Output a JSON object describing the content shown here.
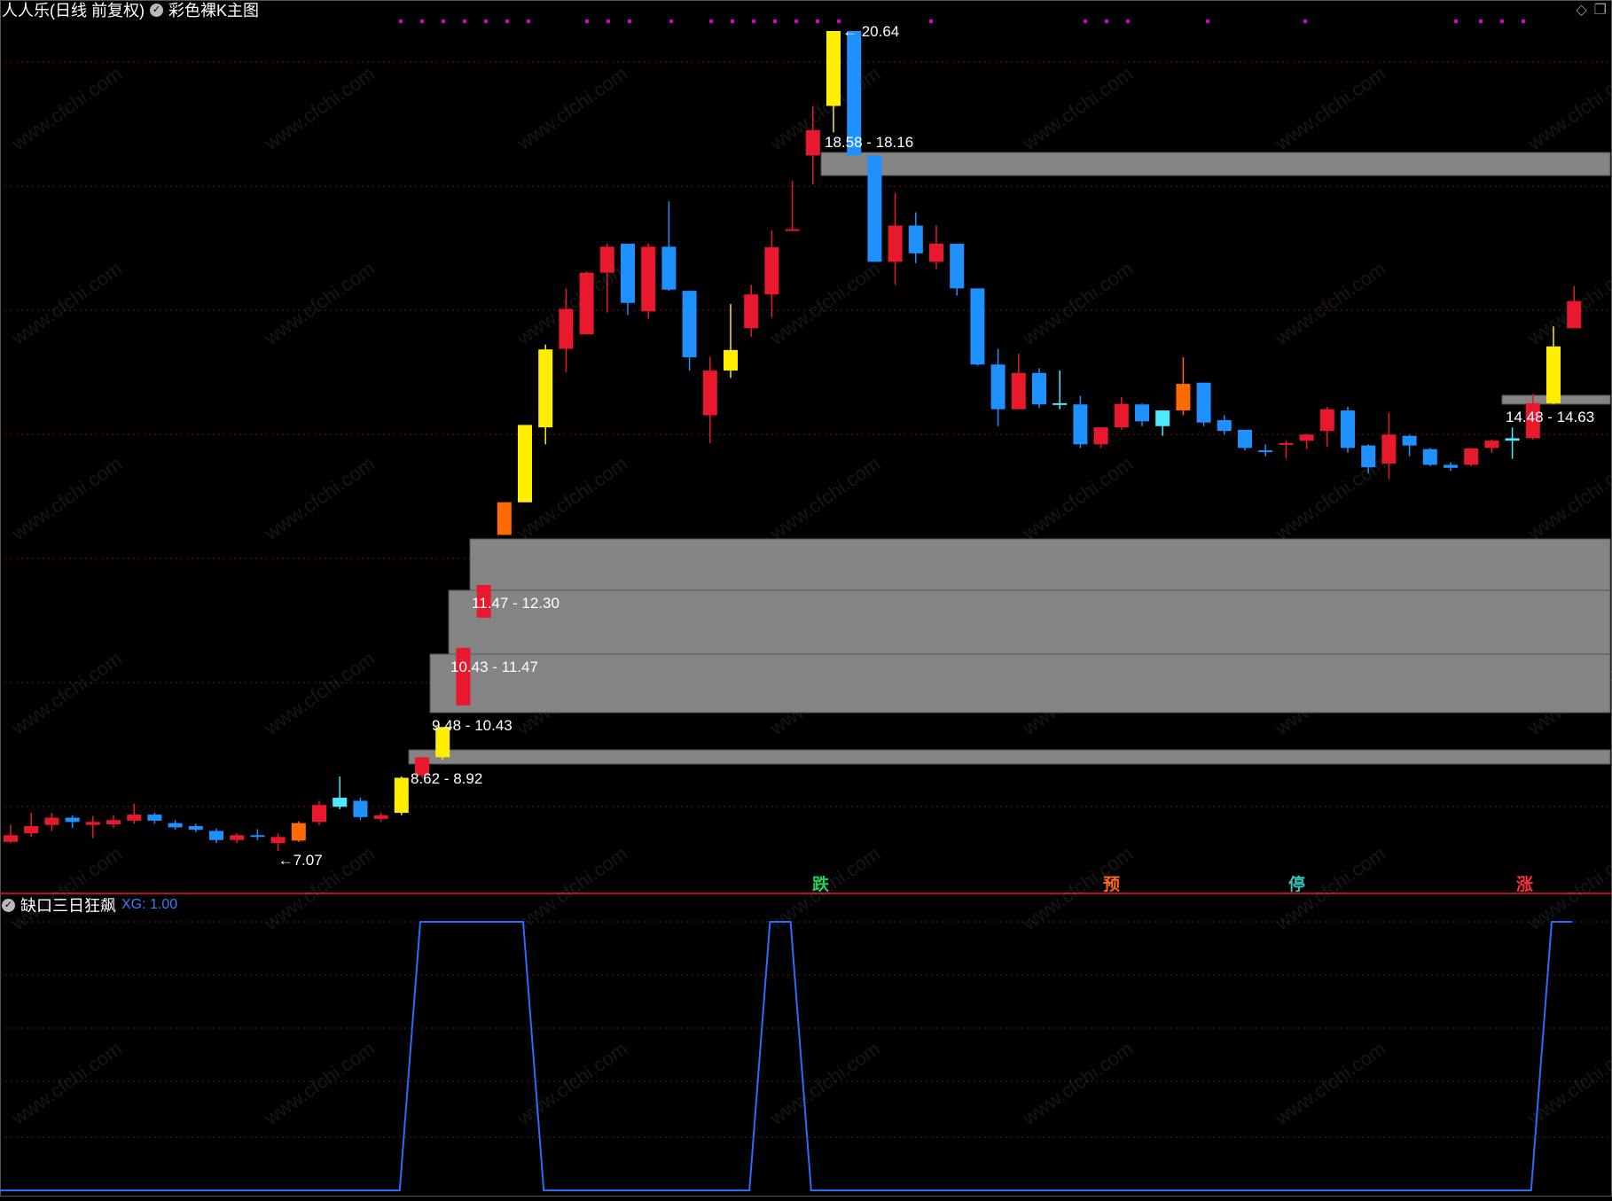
{
  "main_panel": {
    "stock_name": "人人乐(日线 前复权)",
    "indicator_name": "彩色裸K主图"
  },
  "sub_panel": {
    "indicator_name": "缺口三日狂飙",
    "xg_label": "XG: 1.00"
  },
  "icons": [
    "check-circle-icon",
    "diamond-icon",
    "window-restore-icon"
  ],
  "colors": {
    "background": "#000000",
    "grid": "#7a1010",
    "gap_band": "#848484",
    "up": "#e8192c",
    "down": "#1e90ff",
    "yellow": "#ffee00",
    "green": "#00e000",
    "orange": "#ff6a00",
    "cyan": "#4ee8ff",
    "xg_line": "#2a6cff",
    "dots": "#d000d0"
  },
  "price_labels": {
    "high": "20.64",
    "low": "7.07"
  },
  "gaps": [
    {
      "label": "18.58 - 18.16"
    },
    {
      "label": "14.48 - 14.63"
    },
    {
      "label": "11.47 - 12.30"
    },
    {
      "label": "10.43 - 11.47"
    },
    {
      "label": "9.48 - 10.43"
    },
    {
      "label": "8.62 - 8.92"
    }
  ],
  "signals": [
    {
      "text": "跌",
      "color": "#1fd05a"
    },
    {
      "text": "预",
      "color": "#ff6a1a"
    },
    {
      "text": "停",
      "color": "#39c0c0"
    },
    {
      "text": "涨",
      "color": "#ff3040"
    }
  ],
  "candles": [
    {
      "o": 7.33,
      "h": 7.5,
      "l": 7.2,
      "c": 7.22,
      "k": "red"
    },
    {
      "o": 7.36,
      "h": 7.7,
      "l": 7.3,
      "c": 7.48,
      "k": "red"
    },
    {
      "o": 7.5,
      "h": 7.7,
      "l": 7.4,
      "c": 7.62,
      "k": "red"
    },
    {
      "o": 7.62,
      "h": 7.66,
      "l": 7.45,
      "c": 7.55,
      "k": "blue"
    },
    {
      "o": 7.5,
      "h": 7.65,
      "l": 7.28,
      "c": 7.55,
      "k": "red"
    },
    {
      "o": 7.51,
      "h": 7.66,
      "l": 7.45,
      "c": 7.58,
      "k": "red"
    },
    {
      "o": 7.57,
      "h": 7.85,
      "l": 7.52,
      "c": 7.67,
      "k": "red"
    },
    {
      "o": 7.67,
      "h": 7.7,
      "l": 7.52,
      "c": 7.57,
      "k": "blue"
    },
    {
      "o": 7.53,
      "h": 7.58,
      "l": 7.42,
      "c": 7.46,
      "k": "blue"
    },
    {
      "o": 7.48,
      "h": 7.52,
      "l": 7.38,
      "c": 7.42,
      "k": "blue"
    },
    {
      "o": 7.4,
      "h": 7.44,
      "l": 7.2,
      "c": 7.25,
      "k": "blue"
    },
    {
      "o": 7.25,
      "h": 7.36,
      "l": 7.2,
      "c": 7.33,
      "k": "red"
    },
    {
      "o": 7.33,
      "h": 7.43,
      "l": 7.25,
      "c": 7.32,
      "k": "blue"
    },
    {
      "o": 7.3,
      "h": 7.36,
      "l": 7.07,
      "c": 7.2,
      "k": "red"
    },
    {
      "o": 7.24,
      "h": 7.56,
      "l": 7.22,
      "c": 7.53,
      "k": "orange"
    },
    {
      "o": 7.55,
      "h": 7.9,
      "l": 7.5,
      "c": 7.83,
      "k": "red"
    },
    {
      "o": 7.8,
      "h": 8.3,
      "l": 7.76,
      "c": 7.95,
      "k": "cyan"
    },
    {
      "o": 7.9,
      "h": 7.95,
      "l": 7.58,
      "c": 7.63,
      "k": "blue"
    },
    {
      "o": 7.6,
      "h": 7.7,
      "l": 7.55,
      "c": 7.66,
      "k": "red"
    },
    {
      "o": 7.7,
      "h": 8.3,
      "l": 7.66,
      "c": 8.28,
      "k": "yellow"
    },
    {
      "o": 8.32,
      "h": 8.62,
      "l": 8.28,
      "c": 8.62,
      "k": "red"
    },
    {
      "o": 8.62,
      "h": 9.12,
      "l": 8.58,
      "c": 9.12,
      "k": "yellow"
    },
    {
      "o": 9.48,
      "h": 10.43,
      "l": 9.48,
      "c": 10.43,
      "k": "red"
    },
    {
      "o": 10.93,
      "h": 11.47,
      "l": 10.93,
      "c": 11.47,
      "k": "red"
    },
    {
      "o": 12.3,
      "h": 12.84,
      "l": 12.3,
      "c": 12.84,
      "k": "orange"
    },
    {
      "o": 12.84,
      "h": 14.12,
      "l": 12.84,
      "c": 14.12,
      "k": "yellow"
    },
    {
      "o": 14.08,
      "h": 15.45,
      "l": 13.8,
      "c": 15.37,
      "k": "yellow"
    },
    {
      "o": 15.38,
      "h": 16.38,
      "l": 15.0,
      "c": 16.04,
      "k": "red"
    },
    {
      "o": 15.62,
      "h": 16.66,
      "l": 15.62,
      "c": 16.64,
      "k": "red"
    },
    {
      "o": 16.64,
      "h": 17.12,
      "l": 15.98,
      "c": 17.07,
      "k": "red"
    },
    {
      "o": 17.12,
      "h": 17.12,
      "l": 15.94,
      "c": 16.14,
      "k": "blue"
    },
    {
      "o": 17.07,
      "h": 17.12,
      "l": 15.88,
      "c": 16.0,
      "k": "red"
    },
    {
      "o": 17.07,
      "h": 17.82,
      "l": 16.34,
      "c": 16.36,
      "k": "blue"
    },
    {
      "o": 16.34,
      "h": 16.34,
      "l": 15.02,
      "c": 15.24,
      "k": "blue"
    },
    {
      "o": 15.02,
      "h": 15.25,
      "l": 13.82,
      "c": 14.28,
      "k": "red"
    },
    {
      "o": 15.36,
      "h": 16.12,
      "l": 14.9,
      "c": 15.02,
      "k": "yellow"
    },
    {
      "o": 15.72,
      "h": 16.44,
      "l": 15.58,
      "c": 16.28,
      "k": "red"
    },
    {
      "o": 16.28,
      "h": 17.34,
      "l": 15.9,
      "c": 17.06,
      "k": "red"
    },
    {
      "o": 17.36,
      "h": 18.16,
      "l": 17.34,
      "c": 17.36,
      "k": "red"
    },
    {
      "o": 18.58,
      "h": 19.4,
      "l": 18.1,
      "c": 19.0,
      "k": "red"
    },
    {
      "o": 19.4,
      "h": 20.64,
      "l": 18.96,
      "c": 20.64,
      "k": "yellow"
    },
    {
      "o": 20.64,
      "h": 20.64,
      "l": 19.0,
      "c": 18.58,
      "k": "blue"
    },
    {
      "o": 18.58,
      "h": 18.58,
      "l": 17.32,
      "c": 16.82,
      "k": "blue"
    },
    {
      "o": 16.82,
      "h": 17.96,
      "l": 16.44,
      "c": 17.42,
      "k": "red"
    },
    {
      "o": 17.42,
      "h": 17.64,
      "l": 16.8,
      "c": 16.96,
      "k": "blue"
    },
    {
      "o": 17.12,
      "h": 17.42,
      "l": 16.7,
      "c": 16.82,
      "k": "red"
    },
    {
      "o": 17.12,
      "h": 17.12,
      "l": 16.26,
      "c": 16.38,
      "k": "blue"
    },
    {
      "o": 16.38,
      "h": 16.38,
      "l": 15.1,
      "c": 15.12,
      "k": "blue"
    },
    {
      "o": 15.12,
      "h": 15.38,
      "l": 14.1,
      "c": 14.38,
      "k": "blue"
    },
    {
      "o": 14.38,
      "h": 15.3,
      "l": 14.38,
      "c": 14.98,
      "k": "red"
    },
    {
      "o": 14.98,
      "h": 15.06,
      "l": 14.4,
      "c": 14.46,
      "k": "blue"
    },
    {
      "o": 14.48,
      "h": 15.02,
      "l": 14.38,
      "c": 14.46,
      "k": "cyan"
    },
    {
      "o": 14.46,
      "h": 14.6,
      "l": 13.74,
      "c": 13.8,
      "k": "blue"
    },
    {
      "o": 13.8,
      "h": 14.08,
      "l": 13.74,
      "c": 14.08,
      "k": "red"
    },
    {
      "o": 14.08,
      "h": 14.58,
      "l": 14.04,
      "c": 14.47,
      "k": "red"
    },
    {
      "o": 14.46,
      "h": 14.48,
      "l": 14.1,
      "c": 14.18,
      "k": "blue"
    },
    {
      "o": 14.36,
      "h": 14.36,
      "l": 13.94,
      "c": 14.1,
      "k": "cyan"
    },
    {
      "o": 14.36,
      "h": 15.24,
      "l": 14.28,
      "c": 14.8,
      "k": "orange"
    },
    {
      "o": 14.82,
      "h": 14.82,
      "l": 14.1,
      "c": 14.16,
      "k": "blue"
    },
    {
      "o": 14.2,
      "h": 14.28,
      "l": 13.96,
      "c": 14.02,
      "k": "blue"
    },
    {
      "o": 14.04,
      "h": 14.04,
      "l": 13.7,
      "c": 13.74,
      "k": "blue"
    },
    {
      "o": 13.7,
      "h": 13.8,
      "l": 13.6,
      "c": 13.7,
      "k": "blue"
    },
    {
      "o": 13.82,
      "h": 13.86,
      "l": 13.56,
      "c": 13.8,
      "k": "red"
    },
    {
      "o": 13.86,
      "h": 13.98,
      "l": 13.72,
      "c": 13.96,
      "k": "red"
    },
    {
      "o": 14.38,
      "h": 14.42,
      "l": 13.76,
      "c": 14.02,
      "k": "red"
    },
    {
      "o": 14.36,
      "h": 14.42,
      "l": 13.66,
      "c": 13.74,
      "k": "blue"
    },
    {
      "o": 13.78,
      "h": 13.8,
      "l": 13.32,
      "c": 13.42,
      "k": "blue"
    },
    {
      "o": 13.48,
      "h": 14.32,
      "l": 13.22,
      "c": 13.96,
      "k": "red"
    },
    {
      "o": 13.94,
      "h": 13.96,
      "l": 13.6,
      "c": 13.78,
      "k": "blue"
    },
    {
      "o": 13.72,
      "h": 13.74,
      "l": 13.44,
      "c": 13.46,
      "k": "blue"
    },
    {
      "o": 13.46,
      "h": 13.5,
      "l": 13.36,
      "c": 13.41,
      "k": "blue"
    },
    {
      "o": 13.46,
      "h": 13.74,
      "l": 13.44,
      "c": 13.73,
      "k": "red"
    },
    {
      "o": 13.74,
      "h": 13.88,
      "l": 13.66,
      "c": 13.86,
      "k": "red"
    },
    {
      "o": 13.86,
      "h": 14.08,
      "l": 13.56,
      "c": 13.9,
      "k": "cyan"
    },
    {
      "o": 13.9,
      "h": 14.63,
      "l": 13.88,
      "c": 14.48,
      "k": "red"
    },
    {
      "o": 14.48,
      "h": 15.75,
      "l": 14.46,
      "c": 15.42,
      "k": "yellow"
    },
    {
      "o": 15.72,
      "h": 16.42,
      "l": 15.72,
      "c": 16.17,
      "k": "red"
    }
  ],
  "xg_series": [
    0,
    0,
    0,
    0,
    0,
    0,
    0,
    0,
    0,
    0,
    0,
    0,
    0,
    0,
    0,
    0,
    0,
    0,
    0,
    0,
    1,
    1,
    1,
    1,
    1,
    1,
    0,
    0,
    0,
    0,
    0,
    0,
    0,
    0,
    0,
    0,
    0,
    1,
    1,
    0,
    0,
    0,
    0,
    0,
    0,
    0,
    0,
    0,
    0,
    0,
    0,
    0,
    0,
    0,
    0,
    0,
    0,
    0,
    0,
    0,
    0,
    0,
    0,
    0,
    0,
    0,
    0,
    0,
    0,
    0,
    0,
    0,
    0,
    0,
    0,
    1,
    1
  ]
}
